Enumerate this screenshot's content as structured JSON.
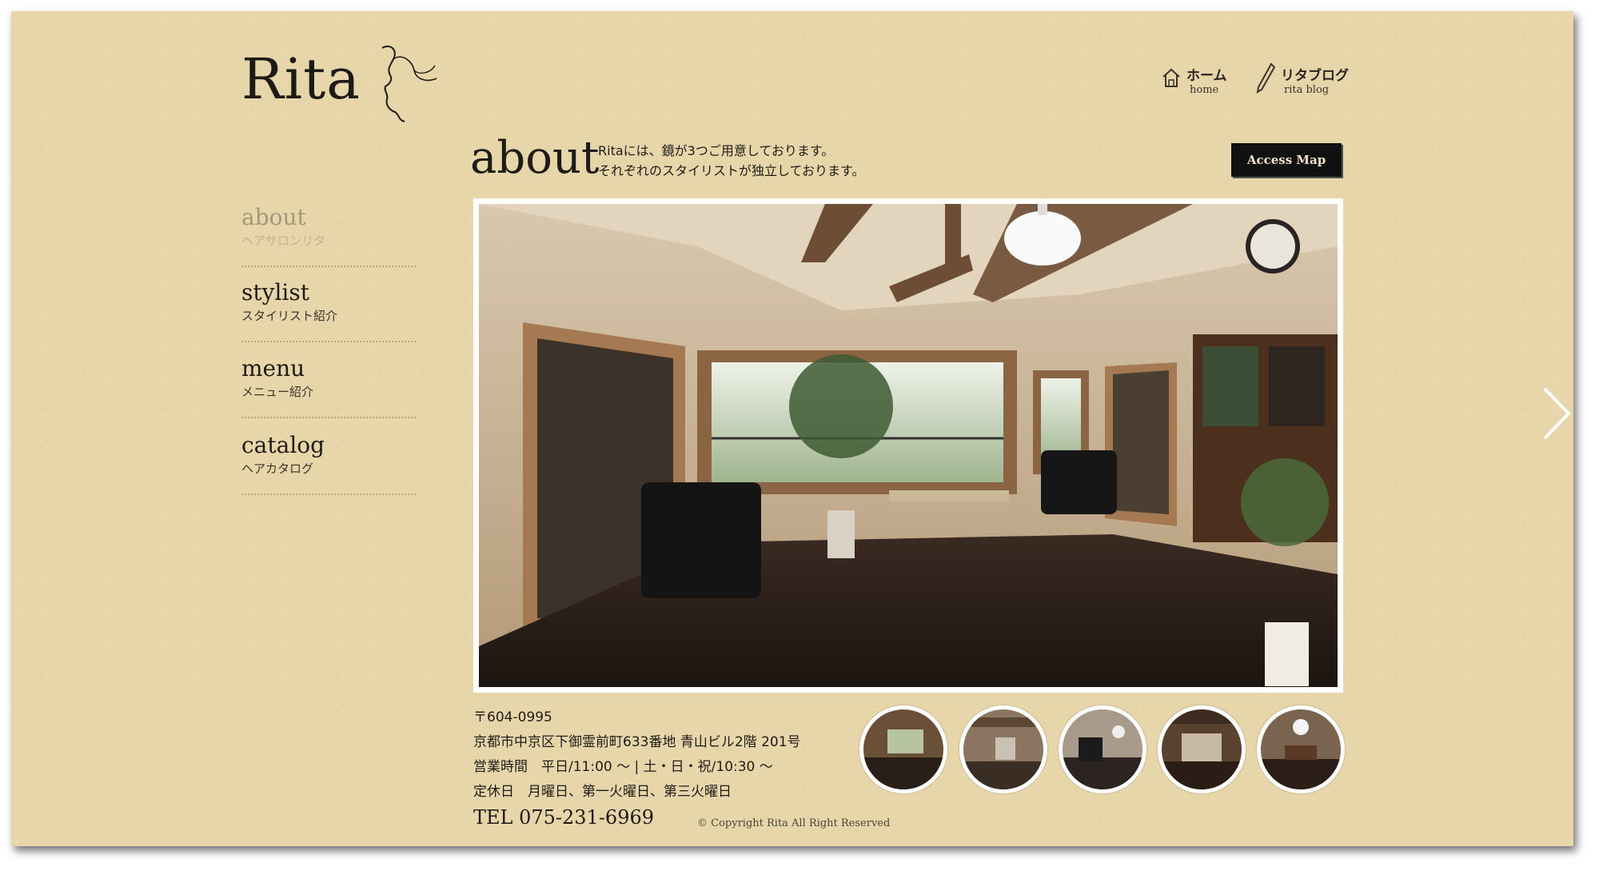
{
  "brand": {
    "name": "Rita"
  },
  "top_nav": [
    {
      "label": "ホーム",
      "sublabel": "home",
      "icon": "house-icon"
    },
    {
      "label": "リタブログ",
      "sublabel": "rita blog",
      "icon": "pen-icon"
    }
  ],
  "side_nav": [
    {
      "label": "about",
      "sublabel": "ヘアサロンリタ",
      "active": true
    },
    {
      "label": "stylist",
      "sublabel": "スタイリスト紹介",
      "active": false
    },
    {
      "label": "menu",
      "sublabel": "メニュー紹介",
      "active": false
    },
    {
      "label": "catalog",
      "sublabel": "ヘアカタログ",
      "active": false
    }
  ],
  "about": {
    "title": "about",
    "desc_line1": "Ritaには、鏡が3つご用意しております。",
    "desc_line2": "それぞれのスタイリストが独立しております。",
    "access_button": "Access Map"
  },
  "info": {
    "postal": "〒604-0995",
    "address": "京都市中京区下御霊前町633番地 青山ビル2階 201号",
    "hours": "営業時間　平日/11:00 ～ | 土・日・祝/10:30 ～",
    "closed": "定休日　月曜日、第一火曜日、第三火曜日",
    "tel": "TEL 075-231-6969",
    "copyright": "© Copyright Rita All Right Reserved"
  },
  "gallery": {
    "thumb_count": 5,
    "next_icon": "chevron-right-icon"
  },
  "colors": {
    "background": "#e8d6ab",
    "text": "#1f1c17",
    "button_bg": "#111111",
    "active_nav": "#a49879"
  }
}
